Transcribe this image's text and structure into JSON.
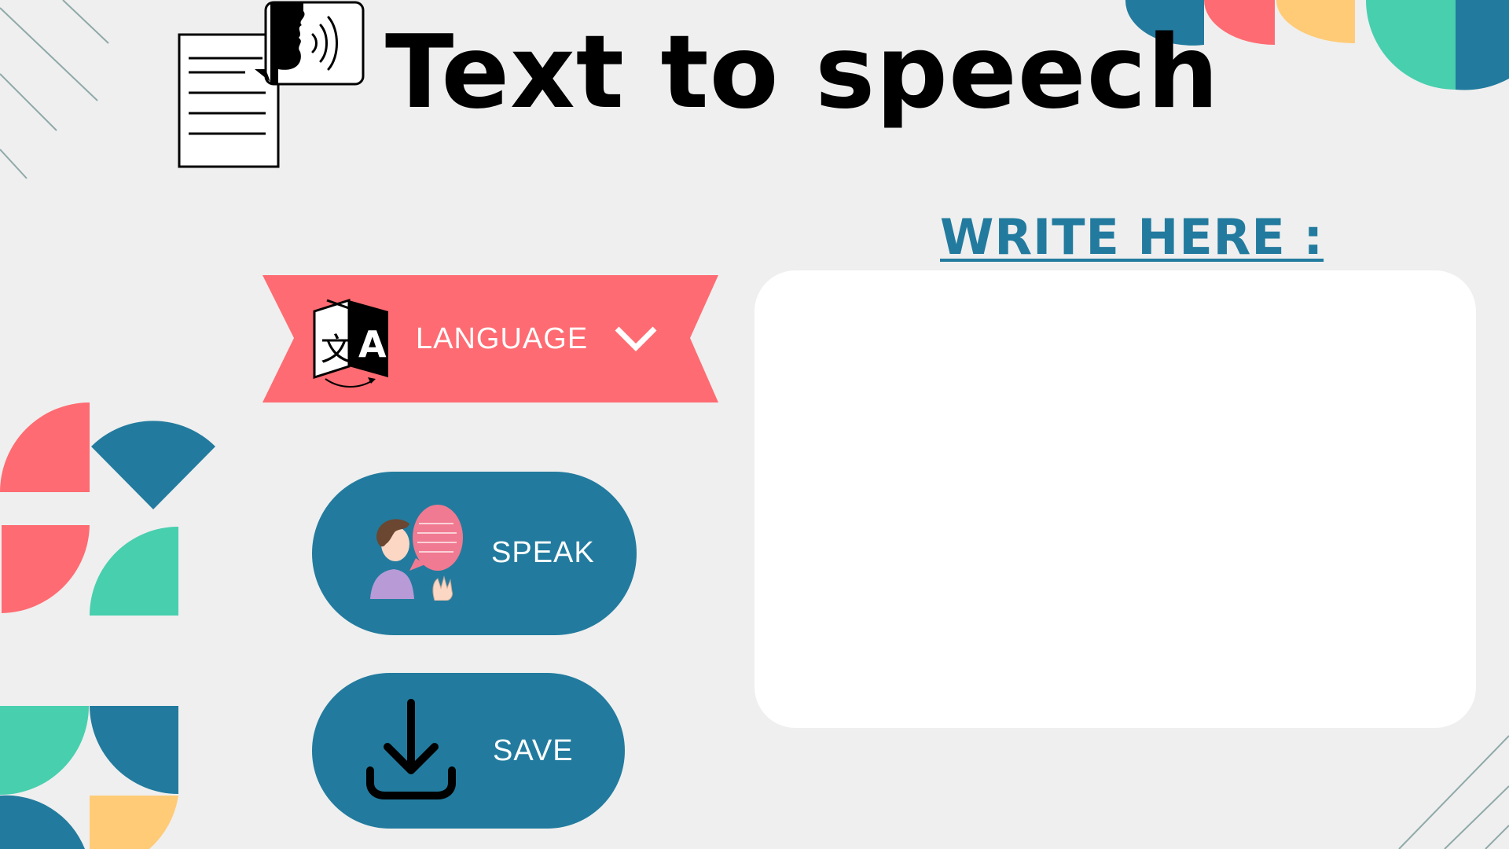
{
  "header": {
    "title": "Text to speech",
    "logo_icon": "text-to-speech-icon"
  },
  "language": {
    "label": "LANGUAGE",
    "icon": "translate-icon",
    "dropdown_icon": "chevron-down-icon"
  },
  "buttons": {
    "speak_label": "SPEAK",
    "speak_icon": "speaker-person-icon",
    "save_label": "SAVE",
    "save_icon": "download-icon"
  },
  "editor": {
    "heading": "WRITE HERE :",
    "value": "",
    "placeholder": ""
  },
  "colors": {
    "background": "#efefef",
    "teal": "#227b9e",
    "coral": "#ff6b72",
    "mint": "#48cfae",
    "yellow": "#ffcb77",
    "white": "#ffffff"
  }
}
